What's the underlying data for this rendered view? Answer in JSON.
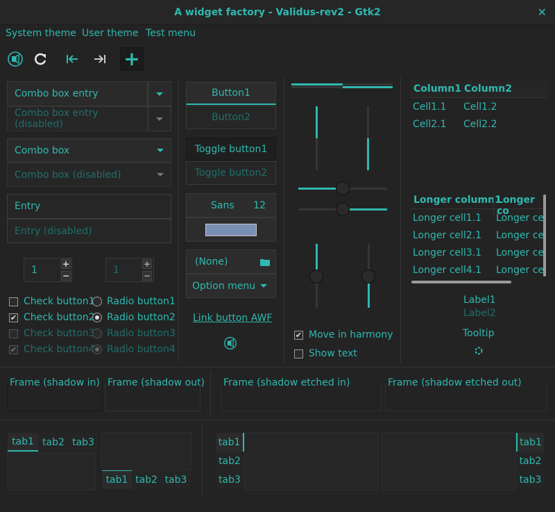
{
  "window": {
    "title": "A widget factory - Validus-rev2 - Gtk2",
    "close_glyph": "✕"
  },
  "menubar": {
    "items": [
      "System theme",
      "User theme",
      "Test menu"
    ]
  },
  "toolbar": {
    "icons": [
      "app-icon",
      "refresh-icon",
      "goto-first-icon",
      "goto-last-icon",
      "add-icon"
    ],
    "add_glyph": "+"
  },
  "combos": {
    "combo_entry": "Combo box entry",
    "combo_entry_disabled": "Combo box entry (disabled)",
    "combo": "Combo box",
    "combo_disabled": "Combo box (disabled)",
    "entry": "Entry",
    "entry_disabled": "Entry (disabled)"
  },
  "spin": {
    "value1": "1",
    "value2": "1",
    "plus": "+",
    "minus": "−"
  },
  "checks": [
    {
      "label": "Check button1",
      "checked": false,
      "disabled": false
    },
    {
      "label": "Check button2",
      "checked": true,
      "disabled": false
    },
    {
      "label": "Check button3",
      "checked": false,
      "disabled": true
    },
    {
      "label": "Check button4",
      "checked": true,
      "disabled": true
    }
  ],
  "radios": [
    {
      "label": "Radio button1",
      "checked": false,
      "disabled": false
    },
    {
      "label": "Radio button2",
      "checked": true,
      "disabled": false
    },
    {
      "label": "Radio button3",
      "checked": false,
      "disabled": true
    },
    {
      "label": "Radio button4",
      "checked": true,
      "disabled": true
    }
  ],
  "check_glyph": "✔",
  "buttons": {
    "button1": "Button1",
    "button2": "Button2",
    "toggle1": "Toggle button1",
    "toggle2": "Toggle button2",
    "font_name": "Sans",
    "font_size": "12",
    "color_swatch": "#7a8fb4",
    "file_chooser": "(None)",
    "option_menu": "Option menu",
    "link": "Link button AWF"
  },
  "sliders": {
    "move_in_harmony": "Move in harmony",
    "show_text": "Show text",
    "move_in_harmony_checked": true,
    "show_text_checked": false
  },
  "tree1": {
    "headers": [
      "Column1",
      "Column2"
    ],
    "rows": [
      [
        "Cell1.1",
        "Cell1.2"
      ],
      [
        "Cell2.1",
        "Cell2.2"
      ]
    ]
  },
  "tree2": {
    "headers": [
      "Longer column1",
      "Longer co"
    ],
    "rows": [
      [
        "Longer cell1.1",
        "Longer ce"
      ],
      [
        "Longer cell2.1",
        "Longer ce"
      ],
      [
        "Longer cell3.1",
        "Longer ce"
      ],
      [
        "Longer cell4.1",
        "Longer ce"
      ]
    ]
  },
  "labels": {
    "label1": "Label1",
    "label2": "Label2",
    "tooltip": "Tooltip"
  },
  "frames": [
    "Frame (shadow in)",
    "Frame (shadow out)",
    "Frame (shadow etched in)",
    "Frame (shadow etched out)"
  ],
  "tabs": [
    "tab1",
    "tab2",
    "tab3"
  ],
  "colors": {
    "accent": "#2fb9b0",
    "background": "#232323",
    "disabled_text": "#1f6f6a"
  }
}
